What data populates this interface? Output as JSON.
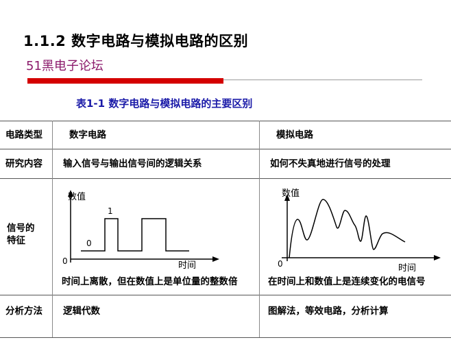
{
  "header": {
    "title": "1.1.2 数字电路与模拟电路的区别",
    "subtitle": "51黑电子论坛"
  },
  "table": {
    "caption": "表1-1 数字电路与模拟电路的主要区别",
    "rows": [
      {
        "head": "电路类型",
        "digital": "数字电路",
        "analog": "模拟电路"
      },
      {
        "head": "研究内容",
        "digital": "输入信号与输出信号间的逻辑关系",
        "analog": "如何不失真地进行信号的处理"
      },
      {
        "head_line1": "信号的",
        "head_line2": "特征",
        "digital": "时间上离散，但在数值上是单位量的整数倍",
        "analog": "在时间上和数值上是连续变化的电信号"
      },
      {
        "head": "分析方法",
        "digital": "逻辑代数",
        "analog": "图解法，等效电路，分析计算"
      }
    ]
  },
  "digital_graph": {
    "y_label": "数值",
    "x_label": "时间",
    "origin": "0",
    "low_label": "0",
    "high_label": "1"
  },
  "analog_graph": {
    "y_label": "数值",
    "x_label": "时间",
    "origin": "0"
  }
}
